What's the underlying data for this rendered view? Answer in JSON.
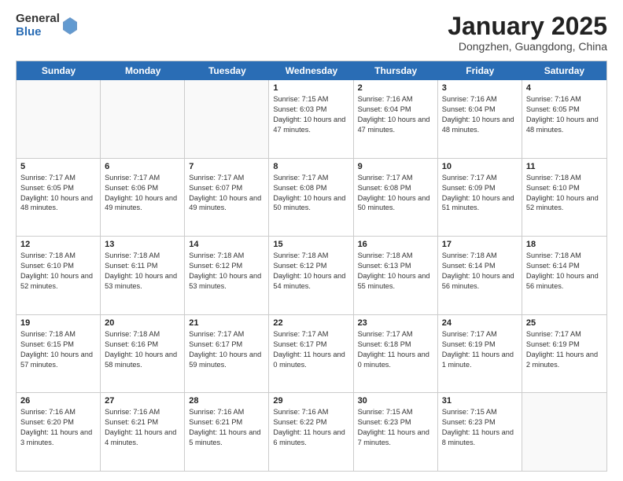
{
  "logo": {
    "general": "General",
    "blue": "Blue"
  },
  "header": {
    "month": "January 2025",
    "location": "Dongzhen, Guangdong, China"
  },
  "days_of_week": [
    "Sunday",
    "Monday",
    "Tuesday",
    "Wednesday",
    "Thursday",
    "Friday",
    "Saturday"
  ],
  "weeks": [
    [
      {
        "day": "",
        "info": ""
      },
      {
        "day": "",
        "info": ""
      },
      {
        "day": "",
        "info": ""
      },
      {
        "day": "1",
        "info": "Sunrise: 7:15 AM\nSunset: 6:03 PM\nDaylight: 10 hours and 47 minutes."
      },
      {
        "day": "2",
        "info": "Sunrise: 7:16 AM\nSunset: 6:04 PM\nDaylight: 10 hours and 47 minutes."
      },
      {
        "day": "3",
        "info": "Sunrise: 7:16 AM\nSunset: 6:04 PM\nDaylight: 10 hours and 48 minutes."
      },
      {
        "day": "4",
        "info": "Sunrise: 7:16 AM\nSunset: 6:05 PM\nDaylight: 10 hours and 48 minutes."
      }
    ],
    [
      {
        "day": "5",
        "info": "Sunrise: 7:17 AM\nSunset: 6:05 PM\nDaylight: 10 hours and 48 minutes."
      },
      {
        "day": "6",
        "info": "Sunrise: 7:17 AM\nSunset: 6:06 PM\nDaylight: 10 hours and 49 minutes."
      },
      {
        "day": "7",
        "info": "Sunrise: 7:17 AM\nSunset: 6:07 PM\nDaylight: 10 hours and 49 minutes."
      },
      {
        "day": "8",
        "info": "Sunrise: 7:17 AM\nSunset: 6:08 PM\nDaylight: 10 hours and 50 minutes."
      },
      {
        "day": "9",
        "info": "Sunrise: 7:17 AM\nSunset: 6:08 PM\nDaylight: 10 hours and 50 minutes."
      },
      {
        "day": "10",
        "info": "Sunrise: 7:17 AM\nSunset: 6:09 PM\nDaylight: 10 hours and 51 minutes."
      },
      {
        "day": "11",
        "info": "Sunrise: 7:18 AM\nSunset: 6:10 PM\nDaylight: 10 hours and 52 minutes."
      }
    ],
    [
      {
        "day": "12",
        "info": "Sunrise: 7:18 AM\nSunset: 6:10 PM\nDaylight: 10 hours and 52 minutes."
      },
      {
        "day": "13",
        "info": "Sunrise: 7:18 AM\nSunset: 6:11 PM\nDaylight: 10 hours and 53 minutes."
      },
      {
        "day": "14",
        "info": "Sunrise: 7:18 AM\nSunset: 6:12 PM\nDaylight: 10 hours and 53 minutes."
      },
      {
        "day": "15",
        "info": "Sunrise: 7:18 AM\nSunset: 6:12 PM\nDaylight: 10 hours and 54 minutes."
      },
      {
        "day": "16",
        "info": "Sunrise: 7:18 AM\nSunset: 6:13 PM\nDaylight: 10 hours and 55 minutes."
      },
      {
        "day": "17",
        "info": "Sunrise: 7:18 AM\nSunset: 6:14 PM\nDaylight: 10 hours and 56 minutes."
      },
      {
        "day": "18",
        "info": "Sunrise: 7:18 AM\nSunset: 6:14 PM\nDaylight: 10 hours and 56 minutes."
      }
    ],
    [
      {
        "day": "19",
        "info": "Sunrise: 7:18 AM\nSunset: 6:15 PM\nDaylight: 10 hours and 57 minutes."
      },
      {
        "day": "20",
        "info": "Sunrise: 7:18 AM\nSunset: 6:16 PM\nDaylight: 10 hours and 58 minutes."
      },
      {
        "day": "21",
        "info": "Sunrise: 7:17 AM\nSunset: 6:17 PM\nDaylight: 10 hours and 59 minutes."
      },
      {
        "day": "22",
        "info": "Sunrise: 7:17 AM\nSunset: 6:17 PM\nDaylight: 11 hours and 0 minutes."
      },
      {
        "day": "23",
        "info": "Sunrise: 7:17 AM\nSunset: 6:18 PM\nDaylight: 11 hours and 0 minutes."
      },
      {
        "day": "24",
        "info": "Sunrise: 7:17 AM\nSunset: 6:19 PM\nDaylight: 11 hours and 1 minute."
      },
      {
        "day": "25",
        "info": "Sunrise: 7:17 AM\nSunset: 6:19 PM\nDaylight: 11 hours and 2 minutes."
      }
    ],
    [
      {
        "day": "26",
        "info": "Sunrise: 7:16 AM\nSunset: 6:20 PM\nDaylight: 11 hours and 3 minutes."
      },
      {
        "day": "27",
        "info": "Sunrise: 7:16 AM\nSunset: 6:21 PM\nDaylight: 11 hours and 4 minutes."
      },
      {
        "day": "28",
        "info": "Sunrise: 7:16 AM\nSunset: 6:21 PM\nDaylight: 11 hours and 5 minutes."
      },
      {
        "day": "29",
        "info": "Sunrise: 7:16 AM\nSunset: 6:22 PM\nDaylight: 11 hours and 6 minutes."
      },
      {
        "day": "30",
        "info": "Sunrise: 7:15 AM\nSunset: 6:23 PM\nDaylight: 11 hours and 7 minutes."
      },
      {
        "day": "31",
        "info": "Sunrise: 7:15 AM\nSunset: 6:23 PM\nDaylight: 11 hours and 8 minutes."
      },
      {
        "day": "",
        "info": ""
      }
    ]
  ]
}
